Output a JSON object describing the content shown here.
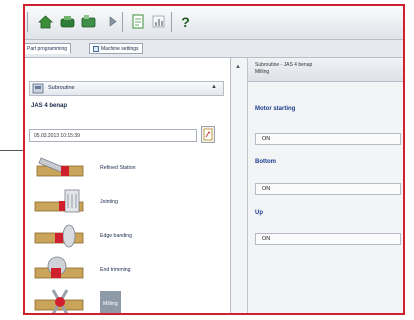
{
  "tabs": [
    {
      "label": "Part programming"
    },
    {
      "label": "Machine settings"
    }
  ],
  "left_panel": {
    "header_label": "Subroutine",
    "process_title": "JAS 4 benap",
    "date_value": "05.03.2013 10:15:39",
    "items": [
      {
        "label": "Refined Station"
      },
      {
        "label": "Jointing"
      },
      {
        "label": "Edge banding"
      },
      {
        "label": "End trimming"
      },
      {
        "label": "Milling"
      }
    ]
  },
  "right_panel": {
    "header_lines": "Subroutine - JAS 4 benap\nMilling",
    "groups": [
      {
        "label": "Motor starting",
        "value": "ON"
      },
      {
        "label": "Bottom",
        "value": "ON"
      },
      {
        "label": "Up",
        "value": "ON"
      }
    ]
  },
  "colors": {
    "frame": "#d0202e",
    "accent": "#1d3f8f"
  }
}
